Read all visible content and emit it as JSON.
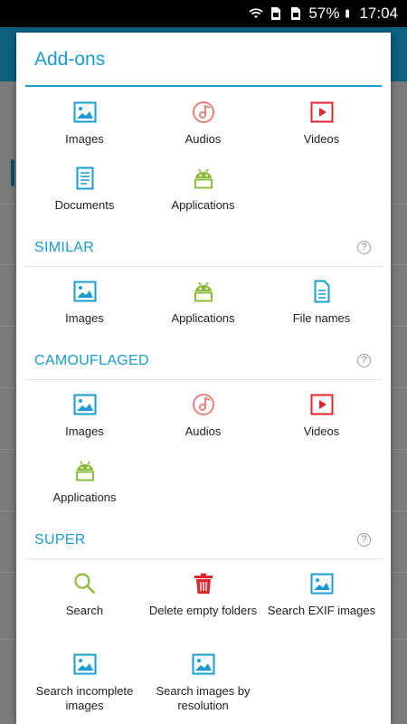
{
  "status_bar": {
    "battery": "57%",
    "time": "17:04"
  },
  "dialog": {
    "title": "Add-ons",
    "main_items": [
      {
        "label": "Images",
        "icon": "image-icon"
      },
      {
        "label": "Audios",
        "icon": "audio-icon"
      },
      {
        "label": "Videos",
        "icon": "video-icon"
      },
      {
        "label": "Documents",
        "icon": "document-icon"
      },
      {
        "label": "Applications",
        "icon": "android-icon"
      }
    ],
    "similar": {
      "title": "SIMILAR",
      "items": [
        {
          "label": "Images",
          "icon": "image-icon"
        },
        {
          "label": "Applications",
          "icon": "android-icon"
        },
        {
          "label": "File names",
          "icon": "file-icon"
        }
      ]
    },
    "camouflaged": {
      "title": "CAMOUFLAGED",
      "items": [
        {
          "label": "Images",
          "icon": "image-icon"
        },
        {
          "label": "Audios",
          "icon": "audio-icon"
        },
        {
          "label": "Videos",
          "icon": "video-icon"
        },
        {
          "label": "Applications",
          "icon": "android-icon"
        }
      ]
    },
    "super": {
      "title": "SUPER",
      "items": [
        {
          "label": "Search",
          "icon": "search-icon"
        },
        {
          "label": "Delete empty folders",
          "icon": "trash-icon"
        },
        {
          "label": "Search EXIF images",
          "icon": "image-icon"
        },
        {
          "label": "Search incomplete images",
          "icon": "image-icon"
        },
        {
          "label": "Search images by resolution",
          "icon": "image-icon"
        }
      ]
    },
    "help_glyph": "?"
  },
  "colors": {
    "accent": "#1a9bd1",
    "audio": "#e8807c",
    "video": "#e0262c",
    "android": "#8cbc3c",
    "search": "#8cbc3c",
    "trash": "#e0262c"
  }
}
